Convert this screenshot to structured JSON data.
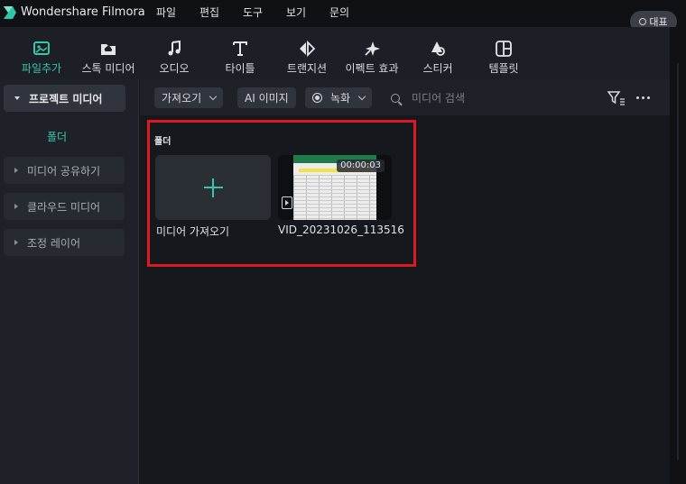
{
  "app": {
    "name": "Wondershare Filmora",
    "represent_label": "대표"
  },
  "menu": [
    "파일",
    "편집",
    "도구",
    "보기",
    "문의"
  ],
  "toolbar": [
    {
      "label": "파일추가",
      "icon": "media-icon",
      "active": true
    },
    {
      "label": "스톡 미디어",
      "icon": "stock-media-icon",
      "active": false
    },
    {
      "label": "오디오",
      "icon": "music-note-icon",
      "active": false
    },
    {
      "label": "타이틀",
      "icon": "title-t-icon",
      "active": false
    },
    {
      "label": "트랜지션",
      "icon": "transition-icon",
      "active": false
    },
    {
      "label": "이펙트 효과",
      "icon": "effects-sparkle-icon",
      "active": false
    },
    {
      "label": "스티커",
      "icon": "sticker-icon",
      "active": false
    },
    {
      "label": "템플릿",
      "icon": "template-grid-icon",
      "active": false
    }
  ],
  "sidebar": {
    "project_media": "프로젝트 미디어",
    "folder": "폴더",
    "items": [
      "미디어 공유하기",
      "클라우드 미디어",
      "조정 레이어"
    ]
  },
  "content_toolbar": {
    "import": "가져오기",
    "ai_image": "AI 이미지",
    "record": "녹화",
    "search_placeholder": "미디어 검색"
  },
  "media": {
    "folder_title": "폴더",
    "import_tile_label": "미디어 가져오기",
    "video": {
      "name": "VID_20231026_113516",
      "duration": "00:00:03"
    }
  },
  "colors": {
    "accent": "#34c8a8",
    "highlight_box": "#e0181f"
  }
}
